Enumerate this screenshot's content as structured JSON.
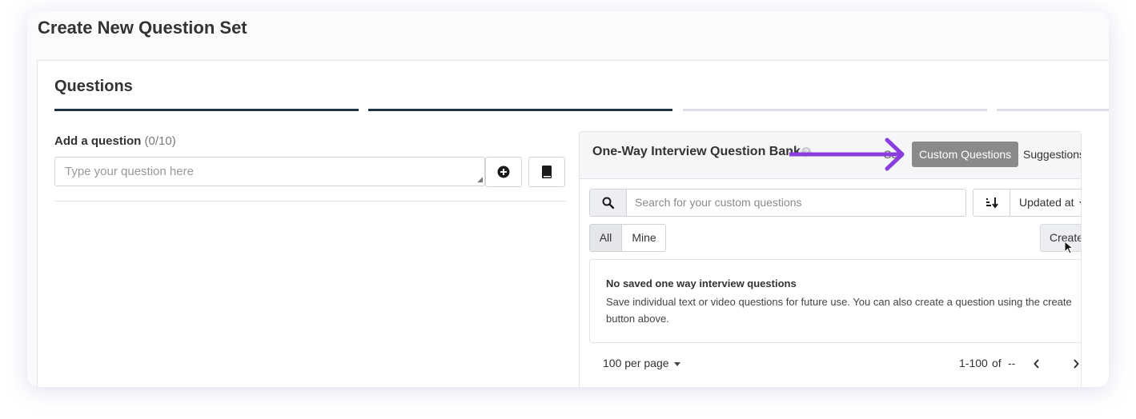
{
  "page": {
    "title": "Create New Question Set"
  },
  "questions": {
    "title": "Questions",
    "add_label": "Add a question",
    "count": "(0/10)",
    "input_placeholder": "Type your question here"
  },
  "bank": {
    "title": "One-Way Interview Question Bank",
    "tab_hidden_partial": "Se",
    "tabs": {
      "custom": "Custom Questions",
      "suggestions": "Suggestions"
    },
    "search_placeholder": "Search for your custom questions",
    "sort_label": "Updated at",
    "filters": {
      "all": "All",
      "mine": "Mine"
    },
    "create_label": "Create",
    "empty_title": "No saved one way interview questions",
    "empty_desc": "Save individual text or video questions for future use. You can also create a question using the create button above.",
    "pagination": {
      "per_page": "100 per page",
      "range": "1-100",
      "of": "of",
      "total": "--"
    }
  },
  "colors": {
    "accent": "#1f3547",
    "annotation_arrow": "#8a3ee0",
    "active_tab": "#8a8a8a"
  }
}
